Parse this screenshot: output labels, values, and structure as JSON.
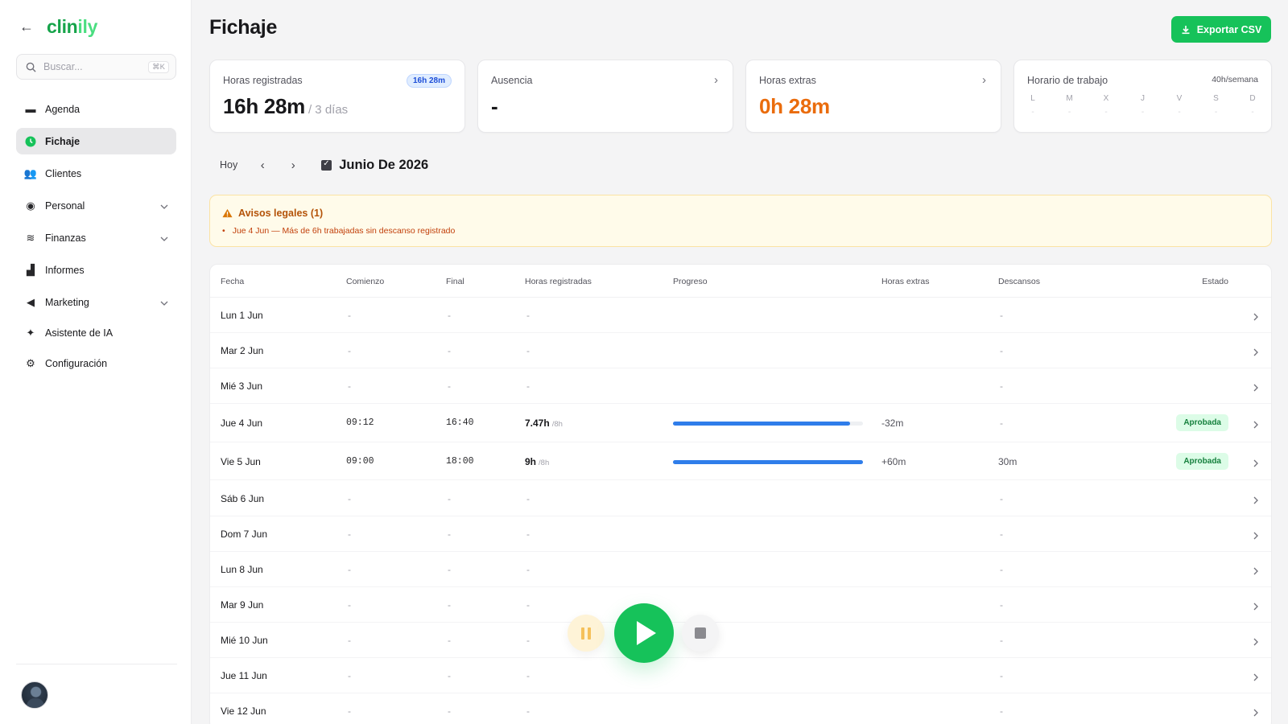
{
  "sidebar": {
    "logo_main": "clin",
    "logo_accent": "ily",
    "search_placeholder": "Buscar...",
    "search_shortcut": "⌘K",
    "items": [
      {
        "label": "Agenda",
        "icon": "calendar-icon",
        "glyph": "▬"
      },
      {
        "label": "Fichaje",
        "icon": "clock-icon",
        "glyph": "◔",
        "active": true
      },
      {
        "label": "Clientes",
        "icon": "users-icon",
        "glyph": "👥"
      },
      {
        "label": "Personal",
        "icon": "user-gear-icon",
        "glyph": "◉",
        "expandable": true
      },
      {
        "label": "Finanzas",
        "icon": "coins-icon",
        "glyph": "≋",
        "expandable": true
      },
      {
        "label": "Informes",
        "icon": "chart-icon",
        "glyph": "▟"
      },
      {
        "label": "Marketing",
        "icon": "megaphone-icon",
        "glyph": "◀",
        "expandable": true
      },
      {
        "label": "Asistente de IA",
        "icon": "sparkle-icon",
        "glyph": "✦"
      },
      {
        "label": "Configuración",
        "icon": "gear-icon",
        "glyph": "⚙"
      }
    ]
  },
  "header": {
    "title": "Fichaje",
    "export_label": "Exportar CSV"
  },
  "cards": {
    "hours": {
      "label": "Horas registradas",
      "badge": "16h 28m",
      "value": "16h 28m",
      "sub": "/ 3 días"
    },
    "absence": {
      "label": "Ausencia",
      "value": "-"
    },
    "overtime": {
      "label": "Horas extras",
      "value": "0h 28m"
    },
    "schedule": {
      "label": "Horario de trabajo",
      "meta": "40h/semana",
      "days": [
        "L",
        "M",
        "X",
        "J",
        "V",
        "S",
        "D"
      ],
      "day_value": "-"
    }
  },
  "datebar": {
    "today": "Hoy",
    "month": "Junio De 2026"
  },
  "alert": {
    "title": "Avisos legales (1)",
    "items": [
      "Jue 4 Jun — Más de 6h trabajadas sin descanso registrado"
    ]
  },
  "table": {
    "headers": [
      "Fecha",
      "Comienzo",
      "Final",
      "Horas registradas",
      "Progreso",
      "Horas extras",
      "Descansos",
      "Estado"
    ],
    "rows": [
      {
        "date": "Lun 1 Jun",
        "start": "-",
        "end": "-",
        "hours": "-",
        "target": "",
        "progress": 0,
        "extra": "",
        "breaks": "-",
        "status": ""
      },
      {
        "date": "Mar 2 Jun",
        "start": "-",
        "end": "-",
        "hours": "-",
        "target": "",
        "progress": 0,
        "extra": "",
        "breaks": "-",
        "status": ""
      },
      {
        "date": "Mié 3 Jun",
        "start": "-",
        "end": "-",
        "hours": "-",
        "target": "",
        "progress": 0,
        "extra": "",
        "breaks": "-",
        "status": ""
      },
      {
        "date": "Jue 4 Jun",
        "start": "09:12",
        "end": "16:40",
        "hours": "7.47h",
        "target": "/8h",
        "progress": 0.934,
        "extra": "-32m",
        "breaks": "-",
        "status": "Aprobada"
      },
      {
        "date": "Vie 5 Jun",
        "start": "09:00",
        "end": "18:00",
        "hours": "9h",
        "target": "/8h",
        "progress": 1.0,
        "extra": "+60m",
        "breaks": "30m",
        "status": "Aprobada"
      },
      {
        "date": "Sáb 6 Jun",
        "start": "-",
        "end": "-",
        "hours": "-",
        "target": "",
        "progress": 0,
        "extra": "",
        "breaks": "-",
        "status": ""
      },
      {
        "date": "Dom 7 Jun",
        "start": "-",
        "end": "-",
        "hours": "-",
        "target": "",
        "progress": 0,
        "extra": "",
        "breaks": "-",
        "status": ""
      },
      {
        "date": "Lun 8 Jun",
        "start": "-",
        "end": "-",
        "hours": "-",
        "target": "",
        "progress": 0,
        "extra": "",
        "breaks": "-",
        "status": ""
      },
      {
        "date": "Mar 9 Jun",
        "start": "-",
        "end": "-",
        "hours": "-",
        "target": "",
        "progress": 0,
        "extra": "",
        "breaks": "-",
        "status": ""
      },
      {
        "date": "Mié 10 Jun",
        "start": "-",
        "end": "-",
        "hours": "-",
        "target": "",
        "progress": 0,
        "extra": "",
        "breaks": "-",
        "status": ""
      },
      {
        "date": "Jue 11 Jun",
        "start": "-",
        "end": "-",
        "hours": "-",
        "target": "",
        "progress": 0,
        "extra": "",
        "breaks": "-",
        "status": ""
      },
      {
        "date": "Vie 12 Jun",
        "start": "-",
        "end": "-",
        "hours": "-",
        "target": "",
        "progress": 0,
        "extra": "",
        "breaks": "-",
        "status": ""
      }
    ]
  },
  "colors": {
    "brand": "#16a34a",
    "accent_green": "#16c25a",
    "overtime_orange": "#ea6c0c",
    "progress_blue": "#2f7dea",
    "alert_text": "#b45309"
  }
}
